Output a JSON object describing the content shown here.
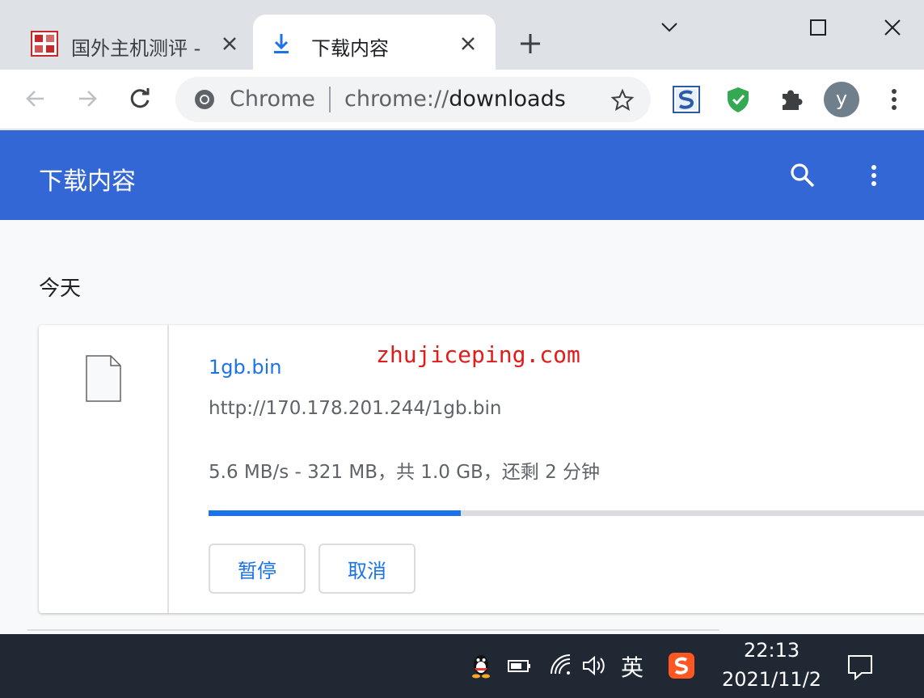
{
  "tabs": [
    {
      "title": "国外主机测评 - ",
      "active": false,
      "favicon": "site-seal-icon"
    },
    {
      "title": "下载内容",
      "active": true,
      "favicon": "download-icon"
    }
  ],
  "omnibox": {
    "site_label": "Chrome",
    "url_scheme": "chrome://",
    "url_host": "downloads"
  },
  "profile": {
    "initial": "y",
    "color": "#6f7f8c"
  },
  "extensions": [
    "s-extension-icon",
    "shield-check-icon",
    "puzzle-icon"
  ],
  "downloads_page": {
    "title": "下载内容",
    "accent": "#3367d6",
    "group_label": "今天",
    "items": [
      {
        "file_name": "1gb.bin",
        "url": "http://170.178.201.244/1gb.bin",
        "status": "5.6 MB/s - 321 MB，共 1.0 GB，还剩 2 分钟",
        "progress": 0.35,
        "pause_label": "暂停",
        "cancel_label": "取消"
      }
    ]
  },
  "watermark": "zhujiceping.com",
  "taskbar": {
    "ime": "英",
    "time": "22:13",
    "date": "2021/11/2"
  }
}
